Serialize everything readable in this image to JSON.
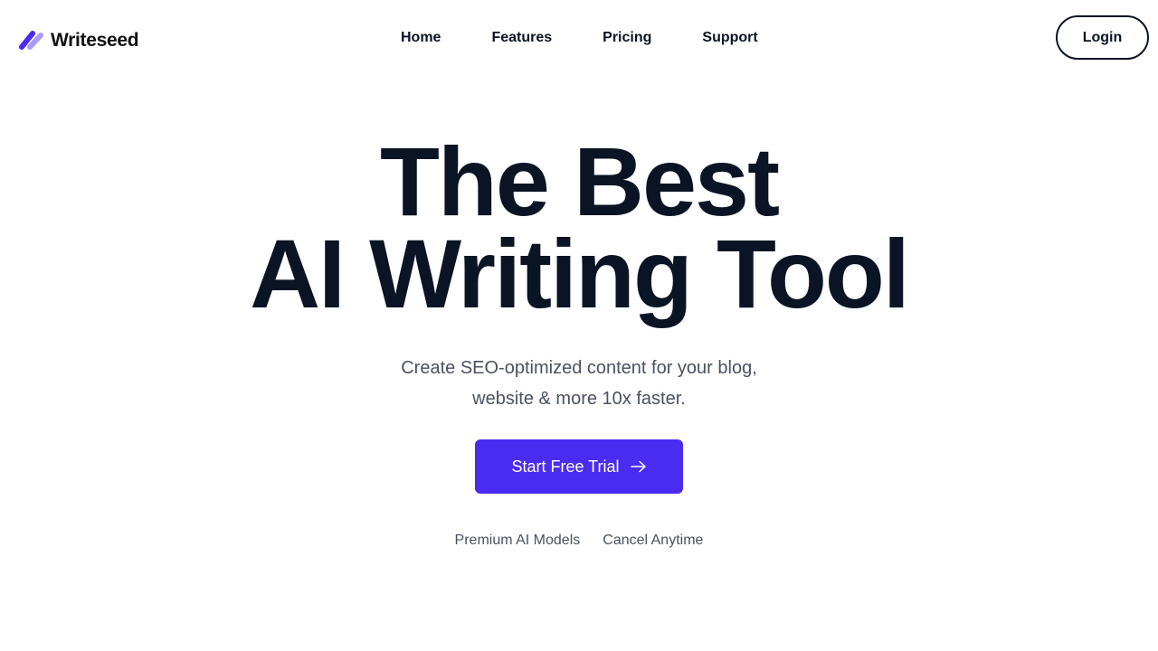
{
  "brand": {
    "name": "Writeseed",
    "logo_colors": [
      "#4a2bf0",
      "#a99bf7"
    ]
  },
  "nav": {
    "items": [
      {
        "label": "Home"
      },
      {
        "label": "Features"
      },
      {
        "label": "Pricing"
      },
      {
        "label": "Support"
      }
    ],
    "login_label": "Login"
  },
  "hero": {
    "title_line1": "The Best",
    "title_line2": "AI Writing Tool",
    "subtitle_line1": "Create SEO-optimized content for your blog,",
    "subtitle_line2": "website & more 10x faster.",
    "cta_label": "Start Free Trial",
    "cta_icon": "arrow-right-icon",
    "features": [
      "Premium AI Models",
      "Cancel Anytime"
    ]
  },
  "colors": {
    "accent": "#4a2bf0",
    "text_dark": "#0b1424",
    "text_muted": "#4a5160",
    "background": "#ffffff"
  }
}
